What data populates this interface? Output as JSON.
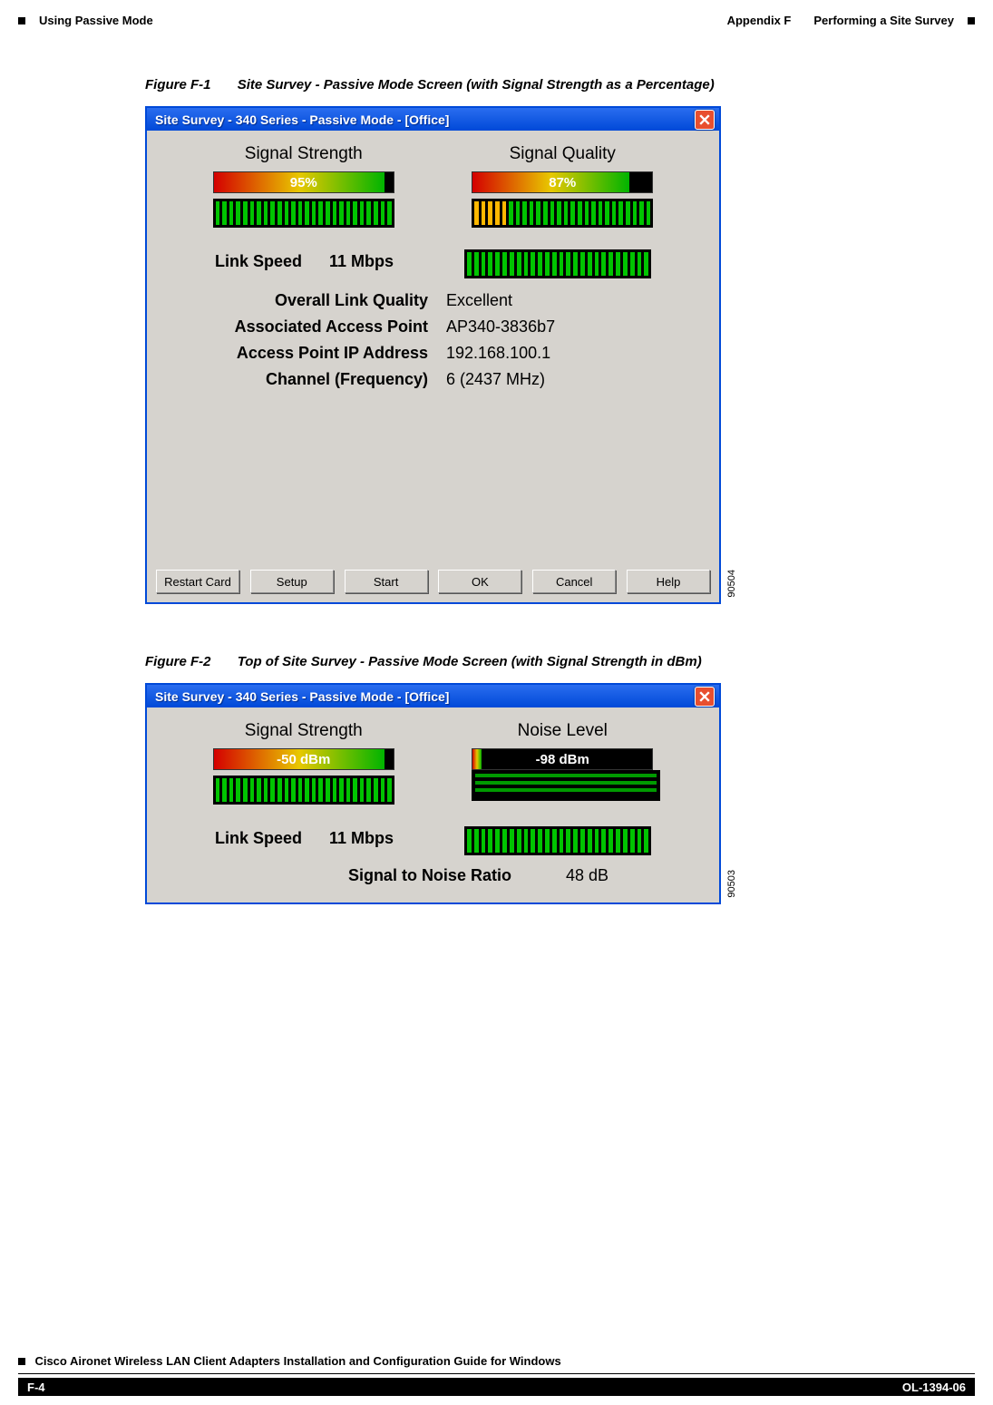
{
  "header": {
    "appendix": "Appendix F",
    "appendix_title": "Performing a Site Survey",
    "section": "Using Passive Mode"
  },
  "figure1": {
    "num": "Figure F-1",
    "caption": "Site Survey - Passive Mode Screen (with Signal Strength as a Percentage)",
    "title": "Site Survey - 340 Series - Passive Mode - [Office]",
    "left_header": "Signal Strength",
    "right_header": "Signal Quality",
    "signal_strength_value": "95%",
    "signal_strength_pct": 95,
    "signal_quality_value": "87%",
    "signal_quality_pct": 87,
    "link_speed_label": "Link Speed",
    "link_speed_value": "11 Mbps",
    "rows": [
      {
        "l": "Overall Link Quality",
        "r": "Excellent"
      },
      {
        "l": "Associated Access Point",
        "r": "AP340-3836b7"
      },
      {
        "l": "Access Point IP Address",
        "r": "192.168.100.1"
      },
      {
        "l": "Channel (Frequency)",
        "r": "6    (2437 MHz)"
      }
    ],
    "buttons": [
      "Restart Card",
      "Setup",
      "Start",
      "OK",
      "Cancel",
      "Help"
    ],
    "side_id": "90504"
  },
  "figure2": {
    "num": "Figure F-2",
    "caption": "Top of Site Survey - Passive Mode Screen (with Signal Strength in dBm)",
    "title": "Site Survey - 340 Series - Passive Mode - [Office]",
    "left_header": "Signal Strength",
    "right_header": "Noise Level",
    "signal_strength_value": "-50 dBm",
    "signal_strength_pct": 95,
    "noise_level_value": "-98 dBm",
    "noise_level_pct": 5,
    "link_speed_label": "Link Speed",
    "link_speed_value": "11 Mbps",
    "snr_label": "Signal to Noise Ratio",
    "snr_value": "48 dB",
    "side_id": "90503"
  },
  "footer": {
    "book_title": "Cisco Aironet Wireless LAN Client Adapters Installation and Configuration Guide for Windows",
    "page": "F-4",
    "doc": "OL-1394-06"
  },
  "colors": {
    "titlebar_blue": "#0049d8",
    "close_red": "#e84f2f",
    "bar_green": "#00b400"
  }
}
